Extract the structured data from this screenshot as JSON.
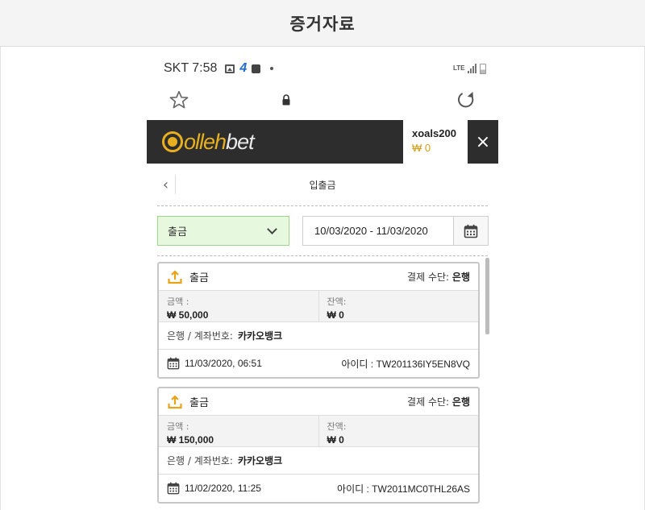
{
  "header": {
    "title": "증거자료"
  },
  "status_bar": {
    "carrier_time": "SKT 7:58",
    "network": "LTE"
  },
  "site": {
    "logo_olleh": "olleh",
    "logo_bet": "bet",
    "username": "xoals200",
    "balance": "₩ 0",
    "close_label": "×"
  },
  "page": {
    "back_label": "‹",
    "title": "입출금"
  },
  "filters": {
    "type_selected": "출금",
    "date_range": "10/03/2020 - 11/03/2020"
  },
  "transactions": [
    {
      "type": "출금",
      "pay_method_label": "결제 수단:",
      "pay_method": "은행",
      "amount_label": "금액 :",
      "amount": "₩ 50,000",
      "balance_label": "잔액:",
      "balance": "₩ 0",
      "bank_label": "은행 / 계좌번호:",
      "bank": "카카오뱅크",
      "datetime": "11/03/2020, 06:51",
      "id_label": "아이디 :",
      "id": "TW201136IY5EN8VQ"
    },
    {
      "type": "출금",
      "pay_method_label": "결제 수단:",
      "pay_method": "은행",
      "amount_label": "금액 :",
      "amount": "₩ 150,000",
      "balance_label": "잔액:",
      "balance": "₩ 0",
      "bank_label": "은행 / 계좌번호:",
      "bank": "카카오뱅크",
      "datetime": "11/02/2020, 11:25",
      "id_label": "아이디 :",
      "id": "TW2011MC0THL26AS"
    }
  ],
  "colors": {
    "accent_gold": "#e8b021",
    "header_dark": "#2d2d2d",
    "select_green": "#e6f8de",
    "icon_orange": "#e8a317"
  }
}
